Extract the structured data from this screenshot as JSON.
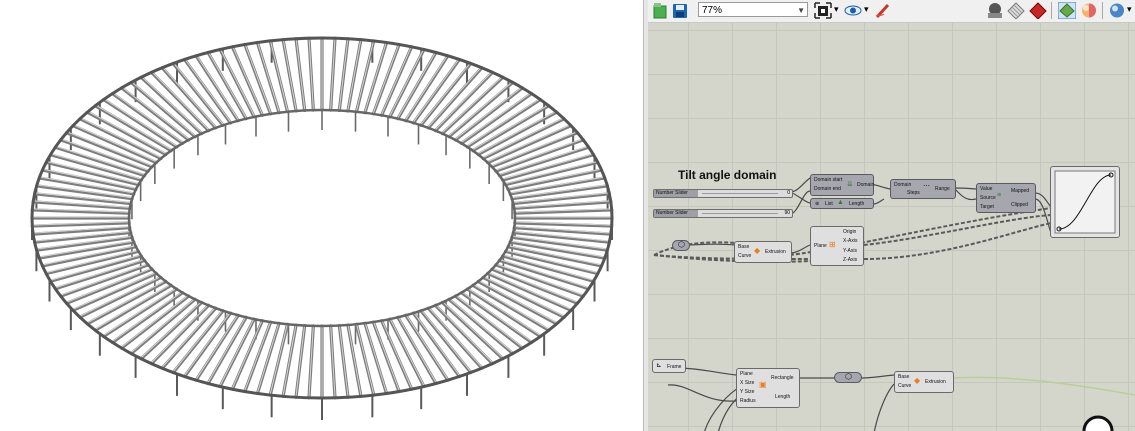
{
  "toolbar": {
    "zoom_value": "77%",
    "icons": [
      "new-document-icon",
      "save-icon",
      "zoom-dropdown",
      "fit-view-icon",
      "preview-eye-icon",
      "sketch-icon",
      "sphere-preview-icon",
      "hatch-preview-icon",
      "red-cube-preview-icon",
      "selected-preview-icon",
      "material-preview-icon",
      "display-options-icon"
    ]
  },
  "canvas": {
    "group_title": "Tilt angle domain",
    "sliders": [
      {
        "label": "Number Slider",
        "value": "0"
      },
      {
        "label": "Number Slider",
        "value": "90"
      }
    ],
    "components": {
      "domain": {
        "inputs": [
          "Domain start",
          "Domain end"
        ],
        "output": "Domain"
      },
      "range": {
        "inputs": [
          "Domain",
          "Steps"
        ],
        "output": "Range"
      },
      "remap": {
        "inputs": [
          "Value",
          "Source",
          "Target"
        ],
        "outputs": [
          "Mapped",
          "Clipped"
        ]
      },
      "list_length": {
        "input": "List",
        "output": "Length"
      },
      "extrusion_1": {
        "inputs": [
          "Base",
          "Curve"
        ],
        "output": "Extrusion"
      },
      "deconstruct_plane": {
        "input": "Plane",
        "outputs": [
          "Origin",
          "X-Axis",
          "Y-Axis",
          "Z-Axis"
        ]
      },
      "frame": {
        "label": "Frame"
      },
      "rectangle": {
        "inputs": [
          "Plane",
          "X Size",
          "Y Size",
          "Radius"
        ],
        "outputs": [
          "Rectangle",
          "Length"
        ]
      },
      "extrusion_2": {
        "inputs": [
          "Base",
          "Curve"
        ],
        "output": "Extrusion"
      }
    }
  },
  "colors": {
    "canvas": "#d4d6cc",
    "component": "#a6a7ae",
    "wire": "#4a4a4a",
    "graph_curve": "#111111"
  }
}
